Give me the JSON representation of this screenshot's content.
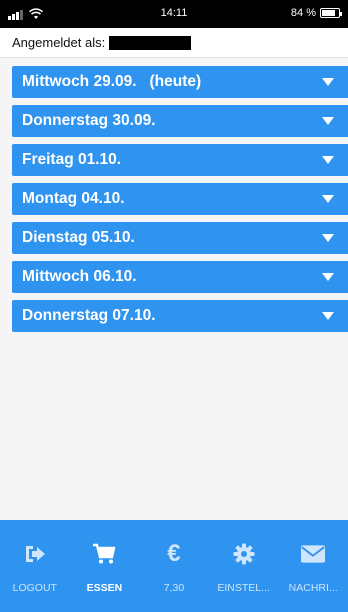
{
  "status_bar": {
    "time": "14:11",
    "battery": "84 %",
    "battery_level": 0.84
  },
  "header": {
    "logged_in_label": "Angemeldet als:"
  },
  "days": [
    {
      "label": "Mittwoch 29.09.   (heute)"
    },
    {
      "label": "Donnerstag 30.09."
    },
    {
      "label": "Freitag 01.10."
    },
    {
      "label": "Montag 04.10."
    },
    {
      "label": "Dienstag 05.10."
    },
    {
      "label": "Mittwoch 06.10."
    },
    {
      "label": "Donnerstag 07.10."
    }
  ],
  "bottom_nav": [
    {
      "label": "LOGOUT",
      "icon": "logout-icon",
      "active": false
    },
    {
      "label": "ESSEN",
      "icon": "cart-icon",
      "active": true
    },
    {
      "label": "7,30",
      "icon": "euro-icon",
      "active": false
    },
    {
      "label": "EINSTEL...",
      "icon": "gear-icon",
      "active": false
    },
    {
      "label": "NACHRI...",
      "icon": "mail-icon",
      "active": false
    }
  ],
  "colors": {
    "accent": "#2f93f0",
    "status_bar": "#000000",
    "text_on_accent": "#ffffff"
  }
}
